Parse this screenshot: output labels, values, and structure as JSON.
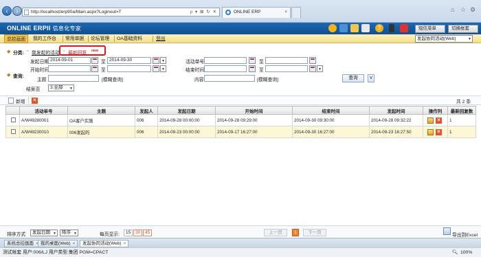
{
  "browser": {
    "address": "http://localhost/erp90a/Main.aspx?Loginout=T",
    "address_controls": "ρ ▾ ⊠ ↻ ✕",
    "tab_title": "ONLINE ERP",
    "tab_close": "×"
  },
  "app": {
    "logo": "ONLINE ERPII",
    "logo_cn": "信息化专家",
    "shortcut_menu": "短信菜单 ▼",
    "switch_account": "切换帐套 ▼"
  },
  "menu": {
    "items": [
      "总控画面",
      "我的工作台",
      "常用单据",
      "论坛管理",
      "OA基础资料",
      "登出"
    ],
    "module_select": "发起协同活动(Web)"
  },
  "filter": {
    "category_label": "分类:",
    "category_mine": "我发起的活动",
    "category_newreply": "最新回复",
    "new_badge": "new",
    "start_date_label": "发起日期",
    "start_date_from": "2014-09-01",
    "to1": "至",
    "start_date_to": "2014-09-30",
    "activity_no_label": "活动单号",
    "to2": "至",
    "query_label": "查询:",
    "begin_time_label": "开始时间",
    "to3": "至",
    "end_time_label": "结束时间",
    "to4": "至",
    "subject_label": "主题",
    "fuzzy1": "[模糊查询]",
    "content_label": "内容",
    "fuzzy2": "[模糊查询]",
    "query_button": "查询",
    "v_button": "V",
    "closed_label": "结案否",
    "closed_value": "3.全部"
  },
  "toolbar": {
    "new_label": "新增",
    "total": "共 2 条"
  },
  "grid": {
    "columns": [
      "",
      "活动单号",
      "主题",
      "发起人",
      "发起日期",
      "开始时间",
      "结束时间",
      "发起时间",
      "操作列",
      "最新回复数"
    ],
    "rows": [
      {
        "no": "A/W49280001",
        "subject": "OA客户实施",
        "initiator": "006",
        "start_date": "2014-09-28 00:00:00",
        "begin": "2014-09-28 09:29:00",
        "end": "2014-09-30 09:30:00",
        "created": "2014-09-28 09:32:22",
        "replies": "1"
      },
      {
        "no": "A/W49230010",
        "subject": "006发起的",
        "initiator": "006",
        "start_date": "2014-09-23 00:00:00",
        "begin": "2014-09-17 16:27:00",
        "end": "2014-09-30 16:27:00",
        "created": "2014-09-23 16:27:50",
        "replies": "1"
      }
    ]
  },
  "pager": {
    "sort_label": "排序方式",
    "sort_field": "发起日期",
    "sort_order": "降序",
    "per_page_label": "每页显示:",
    "sizes": [
      "15",
      "30",
      "45"
    ],
    "prev": "上一页",
    "page": "1",
    "next": "下一页",
    "export": "导出到Excel"
  },
  "taskbar": {
    "tabs": [
      "系统总控画面",
      "我的桌面(Web)",
      "发起协同活动(Web)"
    ],
    "close": "×"
  },
  "status": {
    "text": "测试帐套    用户:006/LJ    用户类型:集团    PGM=CPACT",
    "zoom": "100%"
  },
  "colors": {
    "app_bar": "#1c68b4",
    "menu_bar": "#f5dd86",
    "highlight": "#d9161c",
    "alt_row": "#fdf7d8"
  }
}
